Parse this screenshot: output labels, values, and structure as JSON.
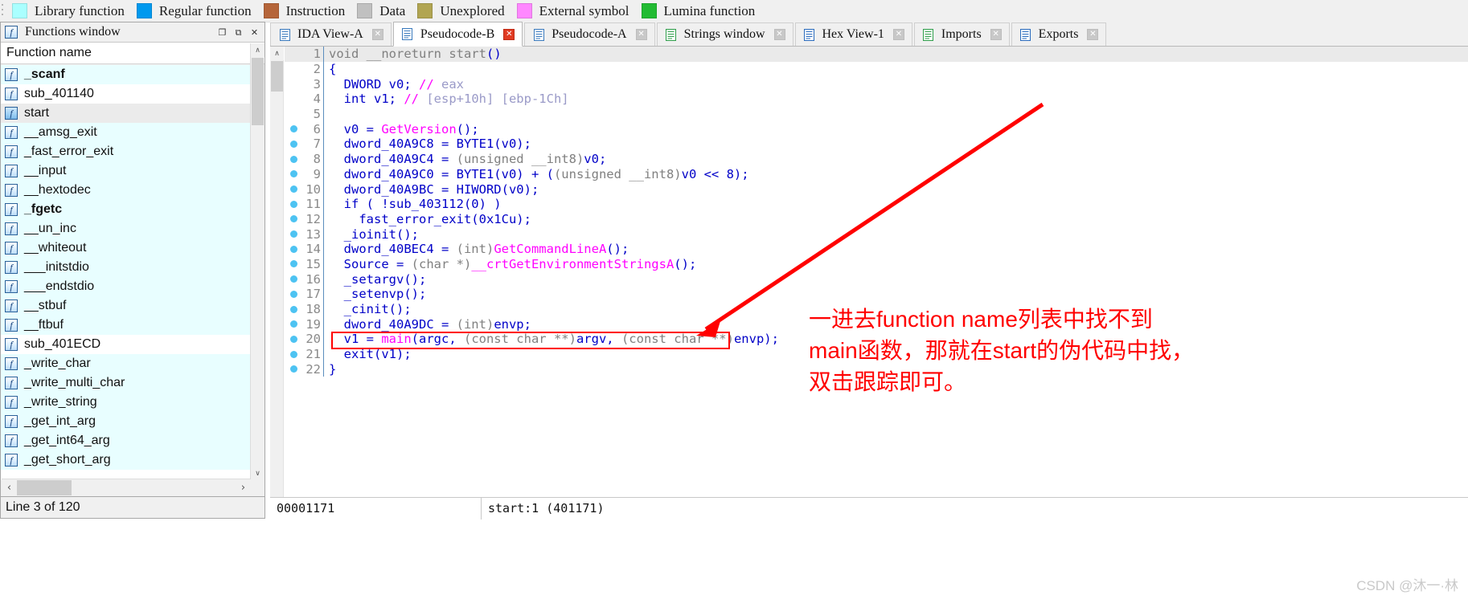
{
  "legend": {
    "items": [
      {
        "label": "Library function",
        "color": "#aaffff"
      },
      {
        "label": "Regular function",
        "color": "#0099ee"
      },
      {
        "label": "Instruction",
        "color": "#b5653a"
      },
      {
        "label": "Data",
        "color": "#c0c0c0"
      },
      {
        "label": "Unexplored",
        "color": "#b1a552"
      },
      {
        "label": "External symbol",
        "color": "#ff88ff"
      },
      {
        "label": "Lumina function",
        "color": "#22bb33"
      }
    ]
  },
  "functions_window": {
    "title": "Functions window",
    "title_icon": "function-icon",
    "restore_button": "❐",
    "maximize_button": "⧉",
    "close_button": "✕",
    "column_header": "Function name",
    "status": "Line 3 of 120",
    "scroll_left_icon": "‹",
    "scroll_right_icon": "›",
    "scroll_up_icon": "∧",
    "scroll_down_icon": "∨",
    "items": [
      {
        "name": "_scanf",
        "bold": true,
        "style": "lib",
        "selected": false
      },
      {
        "name": "sub_401140",
        "bold": false,
        "style": "regular",
        "selected": false
      },
      {
        "name": "start",
        "bold": false,
        "style": "lib",
        "selected": true
      },
      {
        "name": "__amsg_exit",
        "bold": false,
        "style": "lib",
        "selected": false
      },
      {
        "name": "_fast_error_exit",
        "bold": false,
        "style": "lib",
        "selected": false
      },
      {
        "name": "__input",
        "bold": false,
        "style": "lib",
        "selected": false
      },
      {
        "name": "__hextodec",
        "bold": false,
        "style": "lib",
        "selected": false
      },
      {
        "name": "_fgetc",
        "bold": true,
        "style": "lib",
        "selected": false
      },
      {
        "name": "__un_inc",
        "bold": false,
        "style": "lib",
        "selected": false
      },
      {
        "name": "__whiteout",
        "bold": false,
        "style": "lib",
        "selected": false
      },
      {
        "name": "___initstdio",
        "bold": false,
        "style": "lib",
        "selected": false
      },
      {
        "name": "___endstdio",
        "bold": false,
        "style": "lib",
        "selected": false
      },
      {
        "name": "__stbuf",
        "bold": false,
        "style": "lib",
        "selected": false
      },
      {
        "name": "__ftbuf",
        "bold": false,
        "style": "lib",
        "selected": false
      },
      {
        "name": "sub_401ECD",
        "bold": false,
        "style": "regular",
        "selected": false
      },
      {
        "name": "_write_char",
        "bold": false,
        "style": "lib",
        "selected": false
      },
      {
        "name": "_write_multi_char",
        "bold": false,
        "style": "lib",
        "selected": false
      },
      {
        "name": "_write_string",
        "bold": false,
        "style": "lib",
        "selected": false
      },
      {
        "name": "_get_int_arg",
        "bold": false,
        "style": "lib",
        "selected": false
      },
      {
        "name": "_get_int64_arg",
        "bold": false,
        "style": "lib",
        "selected": false
      },
      {
        "name": "_get_short_arg",
        "bold": false,
        "style": "lib",
        "selected": false
      }
    ]
  },
  "tabs": [
    {
      "label": "IDA View-A",
      "icon": "ida-view-icon",
      "active": false
    },
    {
      "label": "Pseudocode-B",
      "icon": "pseudocode-icon",
      "active": true
    },
    {
      "label": "Pseudocode-A",
      "icon": "pseudocode-icon",
      "active": false
    },
    {
      "label": "Strings window",
      "icon": "strings-icon",
      "active": false
    },
    {
      "label": "Hex View-1",
      "icon": "hex-view-icon",
      "active": false
    },
    {
      "label": "Imports",
      "icon": "imports-icon",
      "active": false
    },
    {
      "label": "Exports",
      "icon": "exports-icon",
      "active": false
    }
  ],
  "code": {
    "lines": [
      {
        "n": 1,
        "bp": false,
        "tokens": [
          {
            "t": "void __noreturn ",
            "c": "k-def"
          },
          {
            "t": "start",
            "c": "k-def"
          },
          {
            "t": "()",
            "c": "k-type"
          }
        ]
      },
      {
        "n": 2,
        "bp": false,
        "tokens": [
          {
            "t": "{",
            "c": "k-type"
          }
        ]
      },
      {
        "n": 3,
        "bp": false,
        "tokens": [
          {
            "t": "  DWORD v0; ",
            "c": "k-type"
          },
          {
            "t": "// ",
            "c": "k-slash"
          },
          {
            "t": "eax",
            "c": "k-comment"
          }
        ]
      },
      {
        "n": 4,
        "bp": false,
        "tokens": [
          {
            "t": "  int v1; ",
            "c": "k-type"
          },
          {
            "t": "// ",
            "c": "k-slash"
          },
          {
            "t": "[esp+10h] [ebp-1Ch]",
            "c": "k-comment"
          }
        ]
      },
      {
        "n": 5,
        "bp": false,
        "tokens": [
          {
            "t": "",
            "c": "k-type"
          }
        ]
      },
      {
        "n": 6,
        "bp": true,
        "tokens": [
          {
            "t": "  v0 = ",
            "c": "k-type"
          },
          {
            "t": "GetVersion",
            "c": "k-fn"
          },
          {
            "t": "();",
            "c": "k-type"
          }
        ]
      },
      {
        "n": 7,
        "bp": true,
        "tokens": [
          {
            "t": "  dword_40A9C8 = BYTE1(v0);",
            "c": "k-type"
          }
        ]
      },
      {
        "n": 8,
        "bp": true,
        "tokens": [
          {
            "t": "  dword_40A9C4 = ",
            "c": "k-type"
          },
          {
            "t": "(unsigned __int8)",
            "c": "k-def"
          },
          {
            "t": "v0;",
            "c": "k-type"
          }
        ]
      },
      {
        "n": 9,
        "bp": true,
        "tokens": [
          {
            "t": "  dword_40A9C0 = BYTE1(v0) + (",
            "c": "k-type"
          },
          {
            "t": "(unsigned __int8)",
            "c": "k-def"
          },
          {
            "t": "v0 << 8);",
            "c": "k-type"
          }
        ]
      },
      {
        "n": 10,
        "bp": true,
        "tokens": [
          {
            "t": "  dword_40A9BC = HIWORD(v0);",
            "c": "k-type"
          }
        ]
      },
      {
        "n": 11,
        "bp": true,
        "tokens": [
          {
            "t": "  if ( !sub_403112(0) )",
            "c": "k-type"
          }
        ]
      },
      {
        "n": 12,
        "bp": true,
        "tokens": [
          {
            "t": "    fast_error_exit(0x1Cu);",
            "c": "k-type"
          }
        ]
      },
      {
        "n": 13,
        "bp": true,
        "tokens": [
          {
            "t": "  _ioinit();",
            "c": "k-type"
          }
        ]
      },
      {
        "n": 14,
        "bp": true,
        "tokens": [
          {
            "t": "  dword_40BEC4 = ",
            "c": "k-type"
          },
          {
            "t": "(int)",
            "c": "k-def"
          },
          {
            "t": "GetCommandLineA",
            "c": "k-fn"
          },
          {
            "t": "();",
            "c": "k-type"
          }
        ]
      },
      {
        "n": 15,
        "bp": true,
        "tokens": [
          {
            "t": "  Source = ",
            "c": "k-type"
          },
          {
            "t": "(char *)",
            "c": "k-def"
          },
          {
            "t": "__crtGetEnvironmentStringsA",
            "c": "k-fn"
          },
          {
            "t": "();",
            "c": "k-type"
          }
        ]
      },
      {
        "n": 16,
        "bp": true,
        "tokens": [
          {
            "t": "  _setargv();",
            "c": "k-type"
          }
        ]
      },
      {
        "n": 17,
        "bp": true,
        "tokens": [
          {
            "t": "  _setenvp();",
            "c": "k-type"
          }
        ]
      },
      {
        "n": 18,
        "bp": true,
        "tokens": [
          {
            "t": "  _cinit();",
            "c": "k-type"
          }
        ]
      },
      {
        "n": 19,
        "bp": true,
        "tokens": [
          {
            "t": "  dword_40A9DC = ",
            "c": "k-type"
          },
          {
            "t": "(int)",
            "c": "k-def"
          },
          {
            "t": "envp;",
            "c": "k-type"
          }
        ]
      },
      {
        "n": 20,
        "bp": true,
        "tokens": [
          {
            "t": "  v1 = ",
            "c": "k-type"
          },
          {
            "t": "main",
            "c": "k-fn"
          },
          {
            "t": "(argc, ",
            "c": "k-type"
          },
          {
            "t": "(const char **)",
            "c": "k-def"
          },
          {
            "t": "argv, ",
            "c": "k-type"
          },
          {
            "t": "(const char **)",
            "c": "k-def"
          },
          {
            "t": "envp);",
            "c": "k-type"
          }
        ]
      },
      {
        "n": 21,
        "bp": true,
        "tokens": [
          {
            "t": "  exit(v1);",
            "c": "k-type"
          }
        ]
      },
      {
        "n": 22,
        "bp": true,
        "tokens": [
          {
            "t": "}",
            "c": "k-type"
          }
        ]
      }
    ]
  },
  "annotation": {
    "color": "#ff0000",
    "line1": "一进去function name列表中找不到",
    "line2": "main函数，那就在start的伪代码中找，",
    "line3": "双击跟踪即可。"
  },
  "status_bar": {
    "address": "00001171",
    "location": "start:1 (401171)"
  },
  "watermark": "CSDN @沐一·林"
}
